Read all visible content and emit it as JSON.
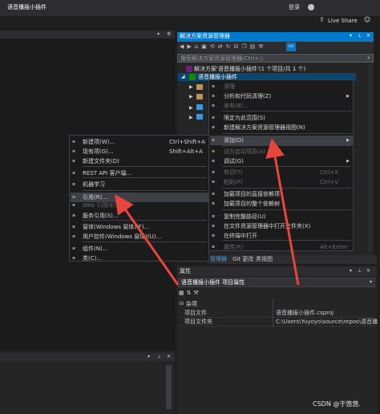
{
  "window": {
    "title": "语音播报小插件",
    "login": "登录",
    "live_share": "Live Share"
  },
  "solution_explorer": {
    "title": "解决方案资源管理器",
    "search_placeholder": "搜索解决方案资源管理器(Ctrl+;)",
    "solution_line": "解决方案'语音播报小插件'(1 个项目/共 1 个)",
    "project_line": "语音播报小插件",
    "tabs": [
      "管理器",
      "Git 更改",
      "类视图"
    ]
  },
  "context_menu": {
    "items": [
      {
        "label": "清理",
        "shortcut": "",
        "disabled": true
      },
      {
        "label": "分析和代码清理(Z)",
        "shortcut": "",
        "disabled": false,
        "submenu": true
      },
      {
        "label": "发布(B)...",
        "shortcut": "",
        "disabled": true
      },
      {
        "label": "限定为此范围(S)",
        "shortcut": "",
        "disabled": false
      },
      {
        "label": "新建解决方案资源管理器视图(N)",
        "shortcut": "",
        "disabled": false
      },
      {
        "label": "添加(D)",
        "shortcut": "",
        "disabled": false,
        "submenu": true,
        "highlighted": true
      },
      {
        "label": "设为启动项目(A)",
        "shortcut": "",
        "disabled": true
      },
      {
        "label": "调试(G)",
        "shortcut": "",
        "disabled": false,
        "submenu": true
      },
      {
        "label": "剪切(T)",
        "shortcut": "Ctrl+X",
        "disabled": true
      },
      {
        "label": "粘贴(P)",
        "shortcut": "Ctrl+V",
        "disabled": true
      },
      {
        "label": "加载项目的直接依赖项",
        "shortcut": "",
        "disabled": false
      },
      {
        "label": "加载项目的整个依赖树",
        "shortcut": "",
        "disabled": false
      },
      {
        "label": "复制完整路径(U)",
        "shortcut": "",
        "disabled": false
      },
      {
        "label": "在文件资源管理器中打开文件夹(X)",
        "shortcut": "",
        "disabled": false
      },
      {
        "label": "在终端中打开",
        "shortcut": "",
        "disabled": false
      },
      {
        "label": "属性(R)",
        "shortcut": "Alt+Enter",
        "disabled": true
      }
    ]
  },
  "add_submenu": {
    "items": [
      {
        "label": "新建项(W)...",
        "shortcut": "Ctrl+Shift+A",
        "disabled": false
      },
      {
        "label": "现有项(G)...",
        "shortcut": "Shift+Alt+A",
        "disabled": false
      },
      {
        "label": "新建文件夹(D)",
        "shortcut": "",
        "disabled": false
      },
      {
        "label": "REST API 客户端...",
        "shortcut": "",
        "disabled": false
      },
      {
        "label": "机器学习",
        "shortcut": "",
        "disabled": false
      },
      {
        "label": "引用(R)...",
        "shortcut": "",
        "disabled": false,
        "highlighted": true
      },
      {
        "label": "Web 引用(E)...",
        "shortcut": "",
        "disabled": true
      },
      {
        "label": "服务引用(S)...",
        "shortcut": "",
        "disabled": false
      },
      {
        "label": "窗体(Windows 窗体)(F)...",
        "shortcut": "",
        "disabled": false
      },
      {
        "label": "用户控件(Windows 窗体)(U)...",
        "shortcut": "",
        "disabled": false
      },
      {
        "label": "组件(N)...",
        "shortcut": "",
        "disabled": false
      },
      {
        "label": "类(C)...",
        "shortcut": "",
        "disabled": false
      }
    ]
  },
  "properties": {
    "title": "属性",
    "header_line": "语音播报小插件  项目属性",
    "category": "杂项",
    "rows": [
      {
        "name": "项目文件",
        "value": "语音播报小插件.csproj"
      },
      {
        "name": "项目文件夹",
        "value": "C:\\Users\\Yuyoyo\\source\\repos\\语音播"
      }
    ]
  },
  "watermark": "CSDN @于悠悠.",
  "colors": {
    "accent": "#007acc",
    "arrow": "#e8453c",
    "background": "#1e1e1e"
  }
}
